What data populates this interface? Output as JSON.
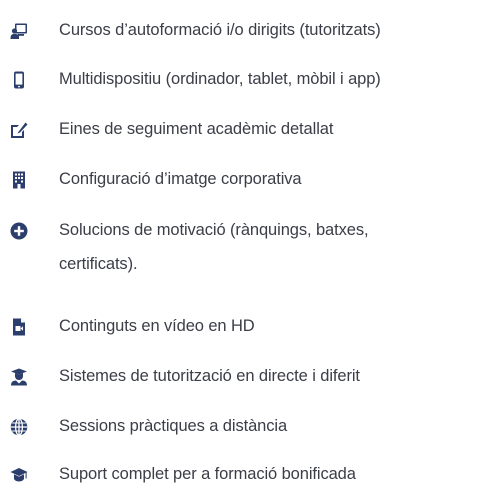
{
  "features": {
    "items": [
      {
        "icon": "chalkboard-teacher-icon",
        "label": "Cursos d’autoformació i/o dirigits (tutoritzats)"
      },
      {
        "icon": "mobile-icon",
        "label": "Multidispositiu (ordinador, tablet, mòbil i app)"
      },
      {
        "icon": "edit-icon",
        "label": "Eines de seguiment acadèmic detallat"
      },
      {
        "icon": "building-icon",
        "label": "Configuració d’imatge corporativa"
      },
      {
        "icon": "plus-circle-icon",
        "label_line1": "Solucions de motivació (rànquings, batxes,",
        "label_line2": "certificats)."
      },
      {
        "icon": "file-video-icon",
        "label": "Continguts en vídeo en HD"
      },
      {
        "icon": "user-graduate-icon",
        "label": "Sistemes de tutorització en directe i diferit"
      },
      {
        "icon": "globe-icon",
        "label": "Sessions pràctiques a distància"
      },
      {
        "icon": "graduation-cap-icon",
        "label": "Suport complet per a formació bonificada"
      }
    ]
  },
  "colors": {
    "icon": "#2c3e6b",
    "text": "#3b3d47",
    "background": "#ffffff"
  }
}
